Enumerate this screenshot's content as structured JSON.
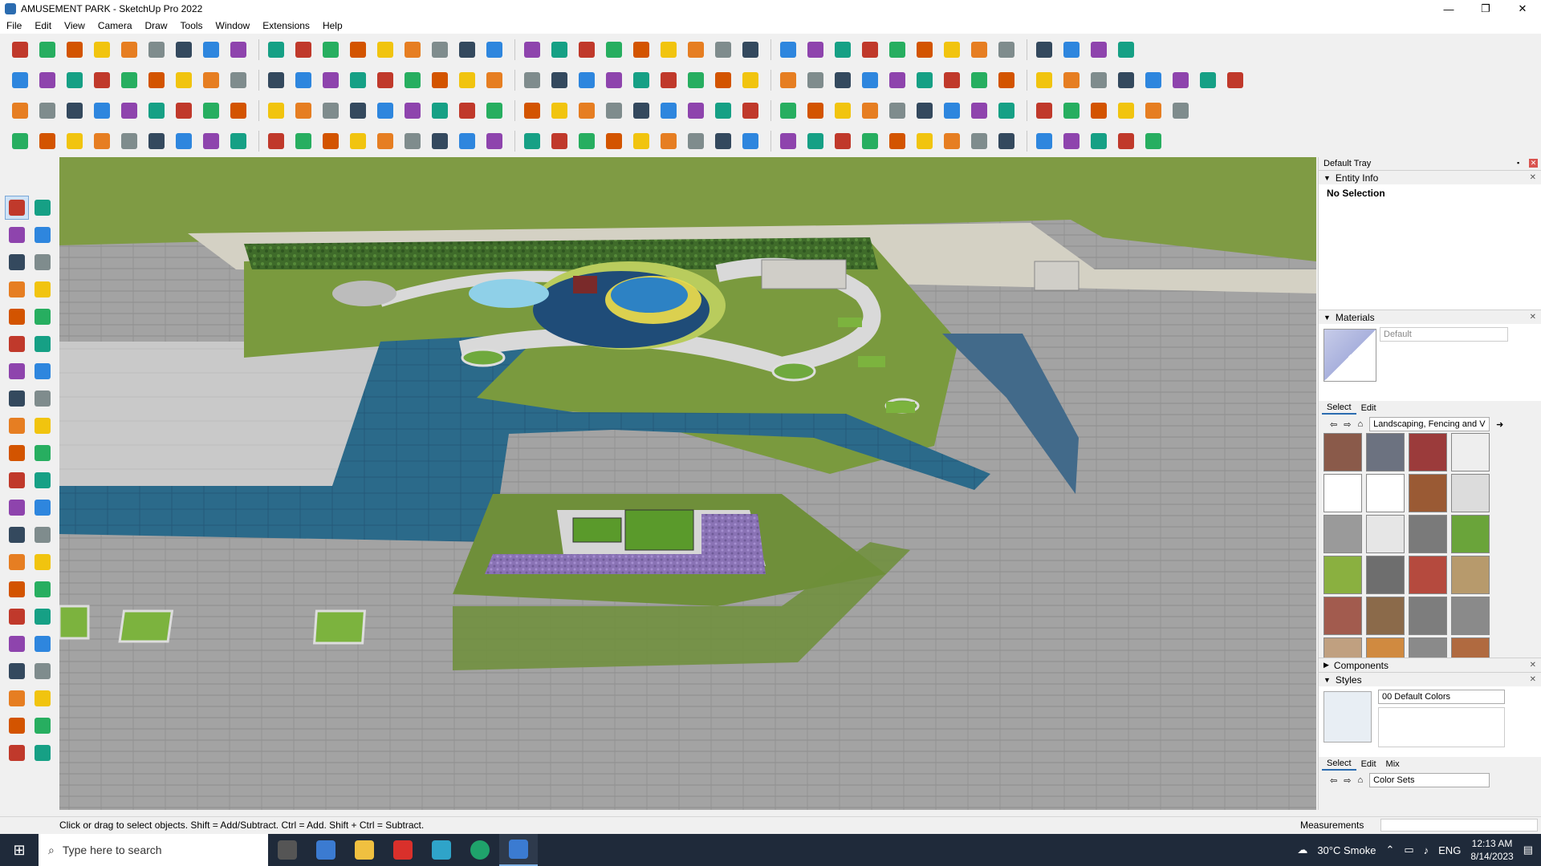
{
  "window": {
    "title": "AMUSEMENT PARK - SketchUp Pro 2022",
    "controls": [
      "—",
      "❐",
      "✕"
    ]
  },
  "menu": [
    "File",
    "Edit",
    "View",
    "Camera",
    "Draw",
    "Tools",
    "Window",
    "Extensions",
    "Help"
  ],
  "toolbar_rows": [
    {
      "count": 40
    },
    {
      "count": 44
    },
    {
      "count": 42
    },
    {
      "count": 41
    }
  ],
  "tray": {
    "title": "Default Tray",
    "entity_info": {
      "label": "Entity Info",
      "value": "No Selection"
    },
    "materials": {
      "label": "Materials",
      "name_placeholder": "Default",
      "tabs": [
        "Select",
        "Edit"
      ],
      "collection": "Landscaping, Fencing and V"
    },
    "components": {
      "label": "Components"
    },
    "styles": {
      "label": "Styles",
      "name": "00 Default Colors",
      "tabs": [
        "Select",
        "Edit",
        "Mix"
      ],
      "collection": "Color Sets"
    }
  },
  "status": {
    "hint": "Click or drag to select objects. Shift = Add/Subtract. Ctrl = Add. Shift + Ctrl = Subtract.",
    "measurements_label": "Measurements"
  },
  "taskbar": {
    "search_placeholder": "Type here to search",
    "weather": "30°C  Smoke",
    "language": "ENG",
    "time": "12:13 AM",
    "date": "8/14/2023"
  },
  "colors": {
    "grass": "#7f9b44",
    "water": "#2e6f8f",
    "paving": "#9a9a9a",
    "accent": "#2b6cb0"
  }
}
